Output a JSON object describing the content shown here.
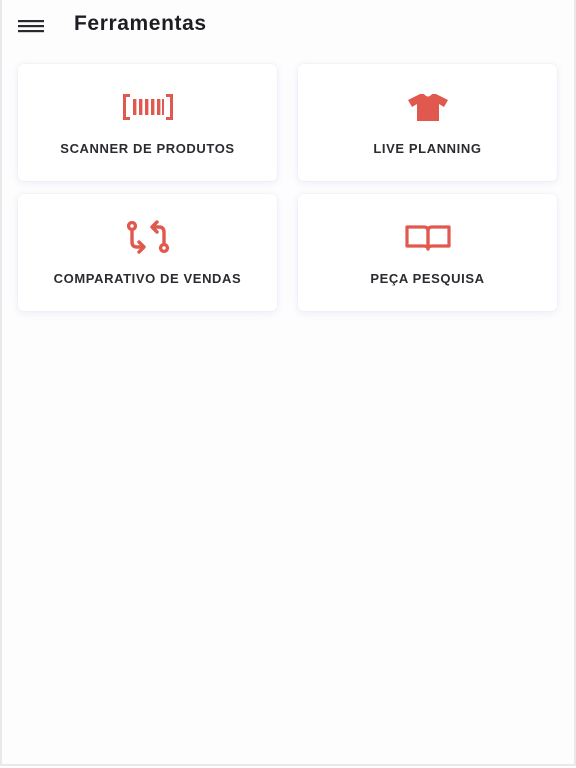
{
  "header": {
    "title": "Ferramentas",
    "menu_icon": "hamburger-menu-icon"
  },
  "accent_color": "#e0584e",
  "tools": [
    {
      "label": "SCANNER DE PRODUTOS",
      "icon": "barcode-icon"
    },
    {
      "label": "LIVE PLANNING",
      "icon": "tshirt-icon"
    },
    {
      "label": "COMPARATIVO DE VENDAS",
      "icon": "compare-arrows-icon"
    },
    {
      "label": "PEÇA PESQUISA",
      "icon": "open-book-icon"
    }
  ]
}
